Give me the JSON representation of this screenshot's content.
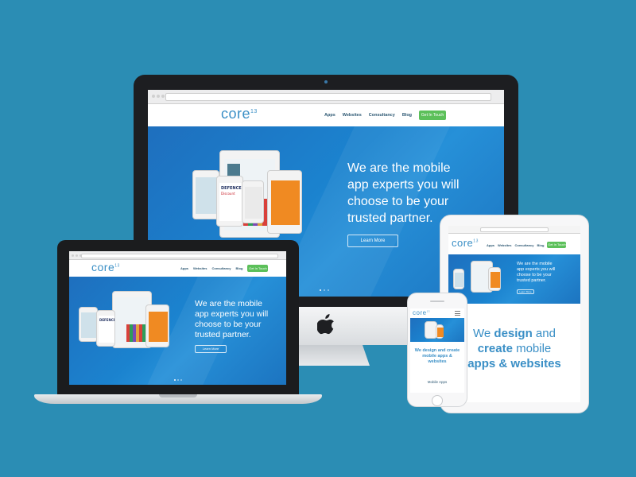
{
  "brand": {
    "logo": "core",
    "logo_sup": "13",
    "accent": "#3a8fc6",
    "cta_color": "#5cc05a",
    "background": "#2b8db4"
  },
  "nav": {
    "apps": "Apps",
    "websites": "Websites",
    "consultancy": "Consultancy",
    "blog": "Blog",
    "cta": "Get In Touch"
  },
  "hero": {
    "line1": "We are the mobile",
    "line2": "app experts you will",
    "line3": "choose to be your",
    "line4": "trusted partner.",
    "button": "Learn More"
  },
  "mock_app": {
    "defence_title": "DEFENCE",
    "defence_sub": "Discount"
  },
  "ipad": {
    "tagline_1": "We ",
    "tagline_bold1": "design",
    "tagline_2": " and",
    "tagline_bold2": "create",
    "tagline_3": " mobile",
    "tagline_4": "apps & websites"
  },
  "iphone": {
    "tagline": "We design and create mobile apps & websites",
    "tagline_a": "We design and create",
    "tagline_b": "mobile apps &",
    "tagline_c": "websites",
    "section": "Mobile Apps"
  },
  "icons": {
    "apple": "apple-logo-icon",
    "hamburger": "menu-icon"
  }
}
